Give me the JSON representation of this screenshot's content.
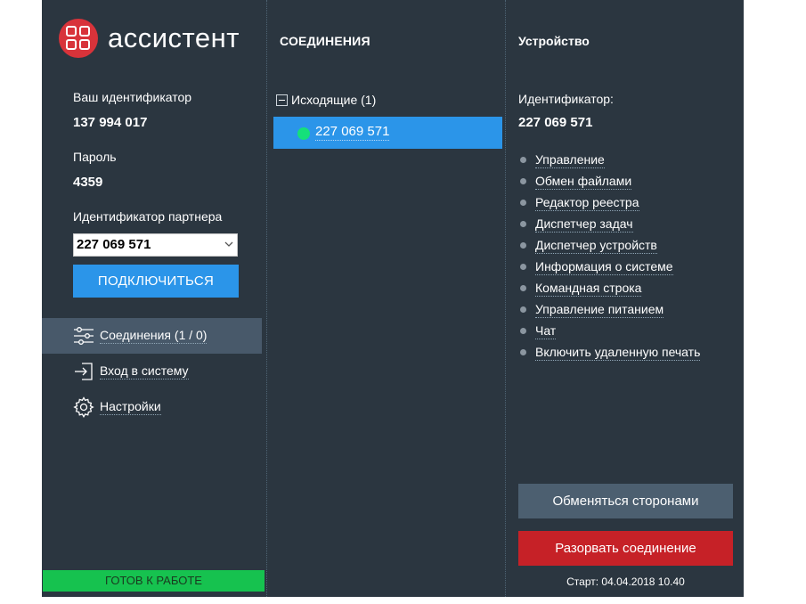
{
  "app": {
    "logo_text": "ассистент"
  },
  "left": {
    "id_label": "Ваш идентификатор",
    "id_value": "137 994 017",
    "password_label": "Пароль",
    "password_value": "4359",
    "partner_label": "Идентификатор партнера",
    "partner_value": "227 069 571",
    "connect_button": "ПОДКЛЮЧИТЬСЯ",
    "nav": [
      {
        "label": "Соединения (1 / 0)",
        "icon": "sliders-icon",
        "active": true
      },
      {
        "label": "Вход в систему",
        "icon": "login-icon",
        "active": false
      },
      {
        "label": "Настройки",
        "icon": "gear-icon",
        "active": false
      }
    ],
    "status": "ГОТОВ К РАБОТЕ",
    "status_color": "#16c24f"
  },
  "middle": {
    "title": "СОЕДИНЕНИЯ",
    "group_label": "Исходящие (1)",
    "connection": "227 069 571",
    "connection_status_color": "#15e07a"
  },
  "right": {
    "title": "Устройство",
    "id_label": "Идентификатор:",
    "id_value": "227 069 571",
    "actions": [
      "Управление",
      "Обмен файлами",
      "Редактор реестра",
      "Диспетчер задач",
      "Диспетчер устройств",
      "Информация о системе",
      "Командная строка",
      "Управление питанием",
      "Чат",
      "Включить удаленную печать"
    ],
    "swap_button": "Обменяться сторонами",
    "disconnect_button": "Разорвать соединение",
    "start_text": "Старт: 04.04.2018 10.40"
  },
  "colors": {
    "background": "#2b3640",
    "accent_blue": "#2b95e9",
    "danger_red": "#c62127",
    "logo_red": "#d8333a"
  }
}
